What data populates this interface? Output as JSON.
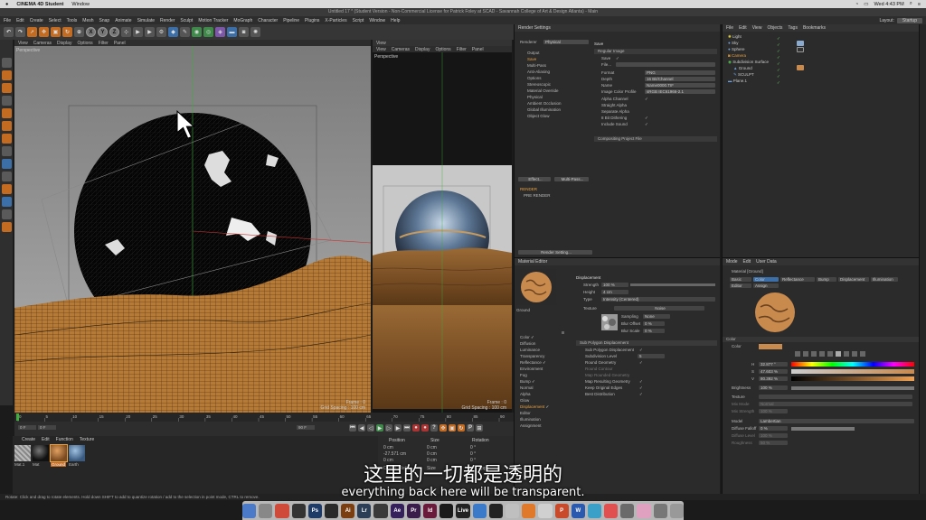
{
  "mac_menubar": {
    "app": "CINEMA 4D Student",
    "menu": "Window",
    "clock": "Wed 4:43 PM"
  },
  "titlebar": {
    "title": "Untitled 17 * (Student Version - Non-Commercial License for Patrick Foley at SCAD - Savannah College of Art & Design Atlanta) - Main"
  },
  "menubar": {
    "items": [
      "File",
      "Edit",
      "Create",
      "Select",
      "Tools",
      "Mesh",
      "Snap",
      "Animate",
      "Simulate",
      "Render",
      "Sculpt",
      "Motion Tracker",
      "MoGraph",
      "Character",
      "Pipeline",
      "Plugins",
      "X-Particles",
      "Script",
      "Window",
      "Help"
    ],
    "layout_label": "Layout:",
    "layout_value": "Startup"
  },
  "toolbar": {
    "axes": [
      "X",
      "Y",
      "Z"
    ]
  },
  "viewport1": {
    "menu": [
      "View",
      "Cameras",
      "Display",
      "Options",
      "Filter",
      "Panel"
    ],
    "label": "Perspective",
    "frame": "Frame : 0",
    "grid": "Grid Spacing : 100 cm"
  },
  "viewport2": {
    "title": "View",
    "menu": [
      "View",
      "Cameras",
      "Display",
      "Options",
      "Filter",
      "Panel"
    ],
    "label": "Perspective",
    "frame": "Frame : 0",
    "grid": "Grid Spacing : 100 cm"
  },
  "render_settings": {
    "title": "Render Settings",
    "renderer_label": "Renderer",
    "renderer_value": "Physical",
    "left_items": [
      "Output",
      "Save",
      "Multi-Pass",
      "Anti-Aliasing",
      "Options",
      "Stereoscopic",
      "Material Override",
      "Physical",
      "Ambient Occlusion",
      "Global Illumination",
      "Object Glow"
    ],
    "save_header": "Save",
    "regular_image": "Regular Image",
    "fields": [
      {
        "label": "Save",
        "value": "✓"
      },
      {
        "label": "File...",
        "value": ""
      },
      {
        "label": "Format",
        "value": "PNG"
      },
      {
        "label": "Depth",
        "value": "16 Bit/Channel"
      },
      {
        "label": "Name",
        "value": "Name0000.TIF"
      },
      {
        "label": "Image Color Profile",
        "value": "sRGB IEC61966-2.1"
      },
      {
        "label": "Alpha Channel",
        "value": "✓"
      },
      {
        "label": "Straight Alpha",
        "value": ""
      },
      {
        "label": "Separate Alpha",
        "value": ""
      },
      {
        "label": "8 Bit Dithering",
        "value": "✓"
      },
      {
        "label": "Include Sound",
        "value": "✓"
      }
    ],
    "compositing": "Compositing Project File",
    "effect_btn": "Effect...",
    "multipass_btn": "Multi-Pass...",
    "render_items": [
      "RENDER",
      "PRE RENDER"
    ],
    "bottom_btn": "Render Setting..."
  },
  "object_manager": {
    "menu": [
      "File",
      "Edit",
      "View",
      "Objects",
      "Tags",
      "Bookmarks"
    ],
    "objects": [
      "Light",
      "Sky",
      "Sphere",
      "Camera",
      "Subdivision Surface",
      "Ground",
      "SCULPT",
      "Plane.1"
    ]
  },
  "material_editor": {
    "title": "Material Editor",
    "material_name": "Ground",
    "channels": [
      {
        "name": "Color",
        "on": true
      },
      {
        "name": "Diffusion",
        "on": false
      },
      {
        "name": "Luminance",
        "on": false
      },
      {
        "name": "Transparency",
        "on": false
      },
      {
        "name": "Reflectance",
        "on": true
      },
      {
        "name": "Environment",
        "on": false
      },
      {
        "name": "Fog",
        "on": false
      },
      {
        "name": "Bump",
        "on": true
      },
      {
        "name": "Normal",
        "on": false
      },
      {
        "name": "Alpha",
        "on": false
      },
      {
        "name": "Glow",
        "on": false
      },
      {
        "name": "Displacement",
        "on": true
      },
      {
        "name": "Editor",
        "on": false
      },
      {
        "name": "Illumination",
        "on": false
      },
      {
        "name": "Assignment",
        "on": false
      }
    ],
    "section": "Displacement",
    "strength_label": "Strength",
    "strength_value": "100 %",
    "height_label": "Height",
    "height_value": "4 cm",
    "type_label": "Type",
    "type_value": "Intensity (Centered)",
    "texture_label": "Texture",
    "texture_value": "Noise",
    "sampling_label": "Sampling",
    "sampling_value": "None",
    "bluroffset_label": "Blur Offset",
    "bluroffset_value": "0 %",
    "blurscale_label": "Blur Scale",
    "blurscale_value": "0 %",
    "subpoly_header": "Sub Polygon Displacement",
    "subpoly_items": [
      {
        "label": "Sub Polygon Displacement",
        "value": "✓"
      },
      {
        "label": "Subdivision Level",
        "value": "5"
      },
      {
        "label": "Round Geometry",
        "value": "✓"
      },
      {
        "label": "Round Contour",
        "value": ""
      },
      {
        "label": "Map Rounded Geometry",
        "value": ""
      },
      {
        "label": "Map Resulting Geometry",
        "value": "✓"
      },
      {
        "label": "Keep Original Edges",
        "value": "✓"
      },
      {
        "label": "Best Distribution",
        "value": "✓"
      }
    ]
  },
  "attribute_manager": {
    "menu": [
      "Mode",
      "Edit",
      "User Data"
    ],
    "material_label": "Material [Ground]",
    "tabs": [
      "Basic",
      "Color",
      "Reflectance",
      "Bump",
      "Displacement",
      "Illumination"
    ],
    "tabs2": [
      "Editor",
      "Assign"
    ],
    "color_section": "Color",
    "color_label": "Color",
    "hsv": [
      {
        "label": "H",
        "value": "32.877 °"
      },
      {
        "label": "S",
        "value": "47.603 %"
      },
      {
        "label": "V",
        "value": "80.392 %"
      }
    ],
    "brightness_label": "Brightness",
    "brightness_value": "100 %",
    "texture_label": "Texture",
    "mixmode_label": "Mix Mode",
    "mixmode_value": "Normal",
    "mixstrength_label": "Mix Strength",
    "mixstrength_value": "100 %",
    "model_label": "Model",
    "model_value": "Lambertian",
    "diffuse_falloff_label": "Diffuse Falloff",
    "diffuse_falloff_value": "0 %",
    "diffuse_level_label": "Diffuse Level",
    "diffuse_level_value": "100 %",
    "roughness_label": "Roughness",
    "roughness_value": "50 %",
    "accent_color": "#c98a4e"
  },
  "timeline": {
    "ticks": [
      "0",
      "5",
      "10",
      "15",
      "20",
      "25",
      "30",
      "35",
      "40",
      "45",
      "50",
      "55",
      "60",
      "65",
      "70",
      "75",
      "80",
      "85",
      "90"
    ],
    "start": "0 F",
    "end": "90 F",
    "current": "0 F"
  },
  "mat_manager": {
    "menu": [
      "Create",
      "Edit",
      "Function",
      "Texture"
    ],
    "materials": [
      "Mat.1",
      "Mat",
      "Ground",
      "Earth"
    ]
  },
  "coords": {
    "headers": [
      "Position",
      "Size",
      "Rotation"
    ],
    "rows": [
      [
        "0 cm",
        "0 cm",
        "0 °"
      ],
      [
        "-27.571 cm",
        "0 cm",
        "0 °"
      ],
      [
        "0 cm",
        "0 cm",
        "0 °"
      ]
    ],
    "mode": "Object (Rel)",
    "size_mode": "Size",
    "apply": "Apply"
  },
  "statusbar": "Rotate: Click and drag to rotate elements. Hold down SHIFT to add to quantize rotation / add to the selection in point mode, CTRL to remove.",
  "dock": [
    {
      "label": "",
      "color": "#4a7ac8"
    },
    {
      "label": "",
      "color": "#888"
    },
    {
      "label": "",
      "color": "#d04a3a"
    },
    {
      "label": "",
      "color": "#333"
    },
    {
      "label": "Ps",
      "color": "#1e3a66"
    },
    {
      "label": "",
      "color": "#2a2a2a"
    },
    {
      "label": "Ai",
      "color": "#7a3e10"
    },
    {
      "label": "Lr",
      "color": "#2b3e55"
    },
    {
      "label": "",
      "color": "#3a3a3a"
    },
    {
      "label": "Ae",
      "color": "#35205c"
    },
    {
      "label": "Pr",
      "color": "#3a1c4a"
    },
    {
      "label": "Id",
      "color": "#6a1a3a"
    },
    {
      "label": "",
      "color": "#1a1a1a"
    },
    {
      "label": "Live",
      "color": "#222"
    },
    {
      "label": "",
      "color": "#3a7ac8"
    },
    {
      "label": "",
      "color": "#222"
    },
    {
      "label": "",
      "color": "#bfbfbf"
    },
    {
      "label": "",
      "color": "#e07a2a"
    },
    {
      "label": "",
      "color": "#d0d0d0"
    },
    {
      "label": "P",
      "color": "#c84a2a"
    },
    {
      "label": "W",
      "color": "#2a5ab0"
    },
    {
      "label": "",
      "color": "#3aa0c8"
    },
    {
      "label": "",
      "color": "#e05050"
    },
    {
      "label": "",
      "color": "#6a6a6a"
    },
    {
      "label": "",
      "color": "#e0a0c0"
    },
    {
      "label": "",
      "color": "#777"
    },
    {
      "label": "",
      "color": "#999"
    }
  ],
  "subtitle": {
    "cn": "这里的一切都是透明的",
    "en": "everything back here will be transparent."
  }
}
